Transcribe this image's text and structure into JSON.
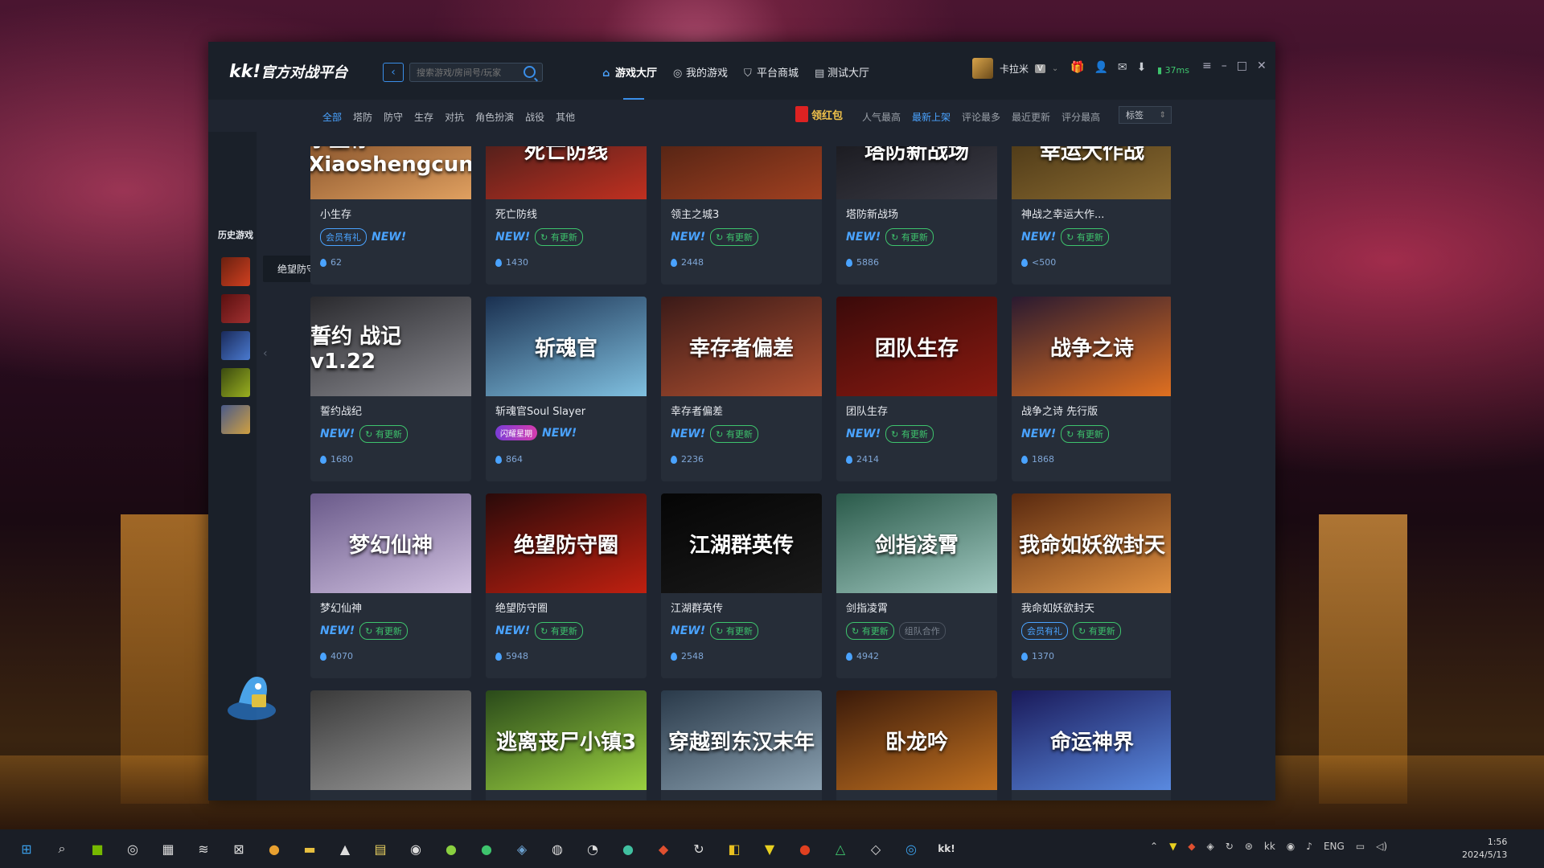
{
  "app": {
    "logo_kk": "kk!",
    "logo_text": "官方对战平台"
  },
  "search": {
    "placeholder": "搜索游戏/房间号/玩家"
  },
  "nav": [
    {
      "label": "游戏大厅",
      "icon": "home-icon"
    },
    {
      "label": "我的游戏",
      "icon": "gamepad-icon"
    },
    {
      "label": "平台商城",
      "icon": "cart-icon"
    },
    {
      "label": "测试大厅",
      "icon": "clipboard-icon"
    }
  ],
  "user": {
    "name": "卡拉米",
    "vip": "V",
    "ping": "37ms"
  },
  "categories": [
    "全部",
    "塔防",
    "防守",
    "生存",
    "对抗",
    "角色扮演",
    "战役",
    "其他"
  ],
  "hongbao_label": "领红包",
  "sorts": [
    "人气最高",
    "最新上架",
    "评论最多",
    "最近更新",
    "评分最高"
  ],
  "tag_select": "标签",
  "history": {
    "title": "历史游戏",
    "tooltip": "绝望防守圈"
  },
  "tag_labels": {
    "new": "NEW!",
    "updated": "有更新",
    "vip": "会员有礼",
    "coop": "组队合作",
    "flash": "闪耀星期"
  },
  "games": [
    {
      "name": "小生存",
      "thumb": "小生存 Xiaoshengcun",
      "pop": "62",
      "tags": [
        "vip",
        "new"
      ],
      "c1": "#6a3a1a",
      "c2": "#e0a060"
    },
    {
      "name": "死亡防线",
      "thumb": "死亡防线",
      "pop": "1430",
      "tags": [
        "new",
        "updated"
      ],
      "c1": "#2a1a1a",
      "c2": "#c03020"
    },
    {
      "name": "领主之城3",
      "thumb": "",
      "pop": "2448",
      "tags": [
        "new",
        "updated"
      ],
      "c1": "#3a1a10",
      "c2": "#a04020"
    },
    {
      "name": "塔防新战场",
      "thumb": "塔防新战场",
      "pop": "5886",
      "tags": [
        "new",
        "updated"
      ],
      "c1": "#101014",
      "c2": "#3a3a44"
    },
    {
      "name": "神战之幸运大作...",
      "thumb": "幸运大作战",
      "pop": "<500",
      "tags": [
        "new",
        "updated"
      ],
      "c1": "#3a2a10",
      "c2": "#8a6a30"
    },
    {
      "name": "誓约战纪",
      "thumb": "誓约 战记 v1.22",
      "pop": "1680",
      "tags": [
        "new",
        "updated"
      ],
      "c1": "#2a2a2e",
      "c2": "#8a8a90"
    },
    {
      "name": "斩魂官Soul Slayer",
      "thumb": "斩魂官",
      "pop": "864",
      "tags": [
        "flash",
        "new"
      ],
      "c1": "#1a3050",
      "c2": "#80c0e0"
    },
    {
      "name": "幸存者偏差",
      "thumb": "幸存者偏差",
      "pop": "2236",
      "tags": [
        "new",
        "updated"
      ],
      "c1": "#3a1a18",
      "c2": "#b05030"
    },
    {
      "name": "团队生存",
      "thumb": "团队生存",
      "pop": "2414",
      "tags": [
        "new",
        "updated"
      ],
      "c1": "#3a0a0a",
      "c2": "#8a1a10"
    },
    {
      "name": "战争之诗 先行版",
      "thumb": "战争之诗",
      "pop": "1868",
      "tags": [
        "new",
        "updated"
      ],
      "c1": "#2a1a30",
      "c2": "#e07020"
    },
    {
      "name": "梦幻仙神",
      "thumb": "梦幻仙神",
      "pop": "4070",
      "tags": [
        "new",
        "updated"
      ],
      "c1": "#6a5a8a",
      "c2": "#d0c0e0"
    },
    {
      "name": "绝望防守圈",
      "thumb": "绝望防守圈",
      "pop": "5948",
      "tags": [
        "new",
        "updated"
      ],
      "c1": "#2a0a0a",
      "c2": "#c02010"
    },
    {
      "name": "江湖群英传",
      "thumb": "江湖群英传",
      "pop": "2548",
      "tags": [
        "new",
        "updated"
      ],
      "c1": "#050505",
      "c2": "#1a1a1a"
    },
    {
      "name": "剑指凌霄",
      "thumb": "剑指凌霄",
      "pop": "4942",
      "tags": [
        "updated",
        "coop"
      ],
      "c1": "#2a5a4a",
      "c2": "#a0c8c0"
    },
    {
      "name": "我命如妖欲封天",
      "thumb": "我命如妖欲封天",
      "pop": "1370",
      "tags": [
        "vip",
        "updated"
      ],
      "c1": "#5a2a10",
      "c2": "#e09040"
    },
    {
      "name": "",
      "thumb": "",
      "pop": "",
      "tags": [],
      "c1": "#3a3a3a",
      "c2": "#9a9a9a"
    },
    {
      "name": "",
      "thumb": "逃离丧尸小镇3",
      "pop": "",
      "tags": [],
      "c1": "#2a4a1a",
      "c2": "#9ad040"
    },
    {
      "name": "",
      "thumb": "穿越到东汉末年",
      "pop": "",
      "tags": [],
      "c1": "#2a3a4a",
      "c2": "#8aa0b0"
    },
    {
      "name": "",
      "thumb": "卧龙吟",
      "pop": "",
      "tags": [],
      "c1": "#3a1a0a",
      "c2": "#c07020"
    },
    {
      "name": "",
      "thumb": "命运神界",
      "pop": "",
      "tags": [],
      "c1": "#1a1a5a",
      "c2": "#5a8ae0"
    }
  ],
  "history_thumbs": [
    {
      "c1": "#6a2010",
      "c2": "#d04020"
    },
    {
      "c1": "#5a1010",
      "c2": "#a03030"
    },
    {
      "c1": "#1a2a5a",
      "c2": "#4a7ad0"
    },
    {
      "c1": "#3a4a10",
      "c2": "#9ab020"
    },
    {
      "c1": "#4a5a8a",
      "c2": "#d0a040"
    }
  ],
  "clock": {
    "time": "1:56",
    "date": "2024/5/13"
  },
  "tray": {
    "lang": "ENG"
  }
}
